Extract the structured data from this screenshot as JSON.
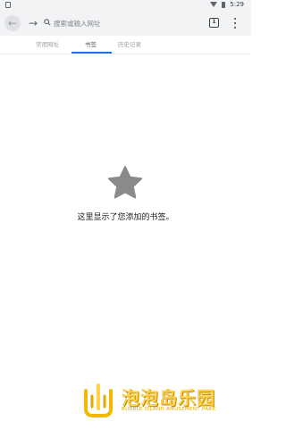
{
  "status_bar": {
    "left_icon": "sim-card-icon",
    "time": "5:29"
  },
  "toolbar": {
    "back_icon": "←",
    "forward_icon": "→",
    "search_placeholder": "搜索或输入网址",
    "tab_count": "1"
  },
  "tabs": [
    {
      "label": "常用网址"
    },
    {
      "label": "书签"
    },
    {
      "label": "历史记录"
    }
  ],
  "empty_state": {
    "icon": "star-icon",
    "message": "这里显示了您添加的书签。"
  },
  "watermark": {
    "title": "泡泡岛乐园",
    "subtitle": "BUBBLE ISLAND AMUSEMENT PARK"
  },
  "colors": {
    "accent": "#1a73e8",
    "star": "#8a8a8a",
    "watermark": "#ffd24a"
  }
}
